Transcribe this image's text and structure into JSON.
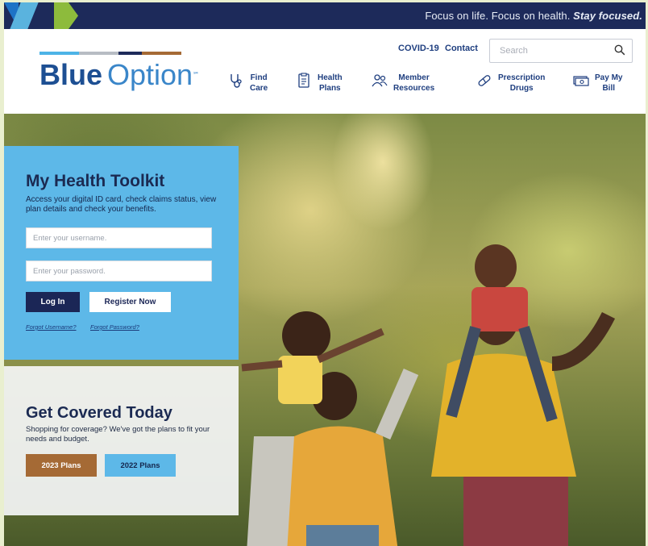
{
  "topbar": {
    "tagline_main": "Focus on life. Focus on health. ",
    "tagline_emph": "Stay focused."
  },
  "logo": {
    "word1": "Blue",
    "word2": "Option",
    "trademark": "℠",
    "stripe_colors": [
      "#4db3e6",
      "#b7bcc3",
      "#1d2a5a",
      "#a56a35"
    ]
  },
  "header": {
    "covid_link": "COVID-19",
    "contact_link": "Contact",
    "search_placeholder": "Search",
    "search_icon": "search-icon"
  },
  "nav": [
    {
      "line1": "Find",
      "line2": "Care",
      "icon": "stethoscope-icon"
    },
    {
      "line1": "Health",
      "line2": "Plans",
      "icon": "document-icon"
    },
    {
      "line1": "Member",
      "line2": "Resources",
      "icon": "people-icon"
    },
    {
      "line1": "Prescription",
      "line2": "Drugs",
      "icon": "pill-icon"
    },
    {
      "line1": "Pay My",
      "line2": "Bill",
      "icon": "money-icon"
    }
  ],
  "toolkit": {
    "title": "My Health Toolkit",
    "description": "Access your digital ID card, check claims status, view plan details and check your benefits.",
    "username_placeholder": "Enter your username.",
    "password_placeholder": "Enter your password.",
    "login_label": "Log In",
    "register_label": "Register Now",
    "forgot_username": "Forgot Username?",
    "forgot_password": "Forgot Password?"
  },
  "covered": {
    "title": "Get Covered Today",
    "description": "Shopping for coverage? We've got the plans to fit your needs and budget.",
    "plans_2023": "2023 Plans",
    "plans_2022": "2022 Plans"
  },
  "colors": {
    "navy": "#1d2a5a",
    "sky": "#5db8e8",
    "bronze": "#a56a35",
    "brand_blue": "#1f5c9e"
  }
}
